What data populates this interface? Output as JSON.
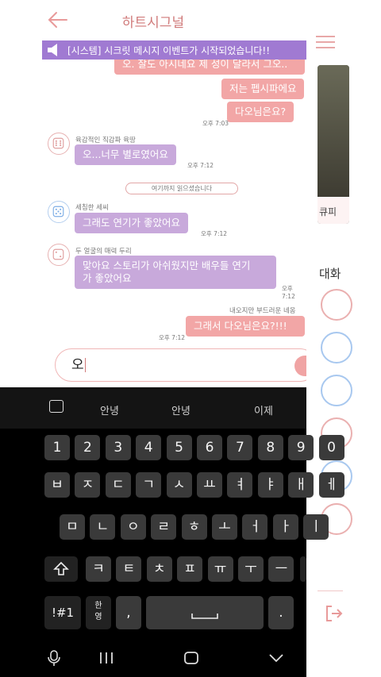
{
  "header": {
    "title": "하트시그널"
  },
  "system_banner": {
    "text": "[시스템] 시크릿 메시지 이벤트가 시작되었습니다!!"
  },
  "messages": [
    {
      "text": "오. 잘도 아시네요 제 성이 달라서 그오..",
      "time": ""
    },
    {
      "text": "저는 펩시파에요",
      "time": ""
    },
    {
      "text": "다오님은요?",
      "time": "오후 7:03"
    },
    {
      "sender": "육감적인 직감파 육땅",
      "text": "오...너무 별로였어요",
      "time": "오후 7:12"
    },
    {
      "divider": "여기까지 읽으셨습니다"
    },
    {
      "sender": "세침한 세씨",
      "text": "그래도 연기가 좋았어요",
      "time": "오후 7:12"
    },
    {
      "sender": "두 얼굴의 매력 두리",
      "text_line1": "맞아요 스토리가 아쉬웠지만 배우들 연기",
      "text_line2": "가 좋았어요",
      "time": "오후 7:12"
    },
    {
      "sender": "내오지만 부드러운 네옹",
      "text": "그래서 다오님은요?!!!",
      "time": "오후 7:12"
    }
  ],
  "input": {
    "value": "오"
  },
  "side_panel": {
    "profile_name": "큐피",
    "section_label": "대화"
  },
  "keyboard": {
    "suggestions": [
      "안녕",
      "안녕",
      "이제"
    ],
    "row_numbers": [
      "1",
      "2",
      "3",
      "4",
      "5",
      "6",
      "7",
      "8",
      "9",
      "0"
    ],
    "row1": [
      "ㅂ",
      "ㅈ",
      "ㄷ",
      "ㄱ",
      "ㅅ",
      "ㅛ",
      "ㅕ",
      "ㅑ",
      "ㅐ",
      "ㅔ"
    ],
    "row2": [
      "ㅁ",
      "ㄴ",
      "ㅇ",
      "ㄹ",
      "ㅎ",
      "ㅗ",
      "ㅓ",
      "ㅏ",
      "ㅣ"
    ],
    "row3": [
      "ㅋ",
      "ㅌ",
      "ㅊ",
      "ㅍ",
      "ㅠ",
      "ㅜ",
      "ㅡ"
    ],
    "symbols_label": "!#1",
    "lang_label_top": "한",
    "lang_label_bottom": "영",
    "comma": ",",
    "period": "."
  },
  "colors": {
    "accent": "#d07a7a",
    "my_bubble": "#f2a6a6",
    "other_bubble": "#c8a9db",
    "banner": "#a07ad2"
  }
}
